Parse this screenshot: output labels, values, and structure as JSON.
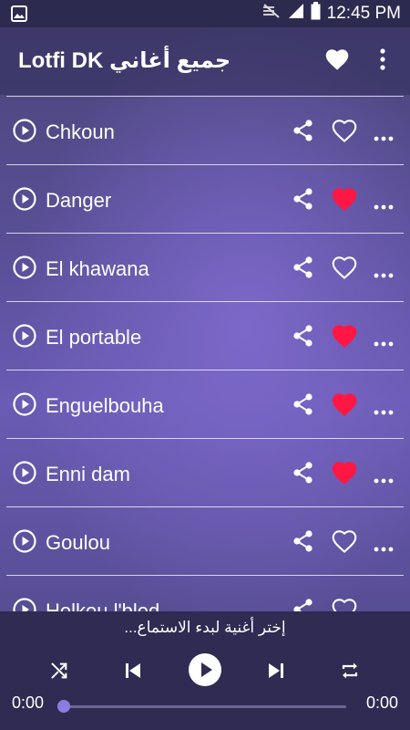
{
  "status_bar": {
    "time": "12:45 PM"
  },
  "app_bar": {
    "title": "Lotfi DK جميع أغاني"
  },
  "songs": [
    {
      "title": "Chkoun",
      "favorite": false
    },
    {
      "title": "Danger",
      "favorite": true
    },
    {
      "title": "El khawana",
      "favorite": false
    },
    {
      "title": "El portable",
      "favorite": true
    },
    {
      "title": "Enguelbouha",
      "favorite": true
    },
    {
      "title": "Enni dam",
      "favorite": true
    },
    {
      "title": "Goulou",
      "favorite": false
    },
    {
      "title": "Holkou l'bled",
      "favorite": false
    }
  ],
  "player": {
    "prompt": "إختر أغنية لبدء الاستماع...",
    "current_time": "0:00",
    "total_time": "0:00",
    "progress": 0
  },
  "colors": {
    "favorite_red": "#ff1744",
    "accent": "#8b7de0"
  }
}
